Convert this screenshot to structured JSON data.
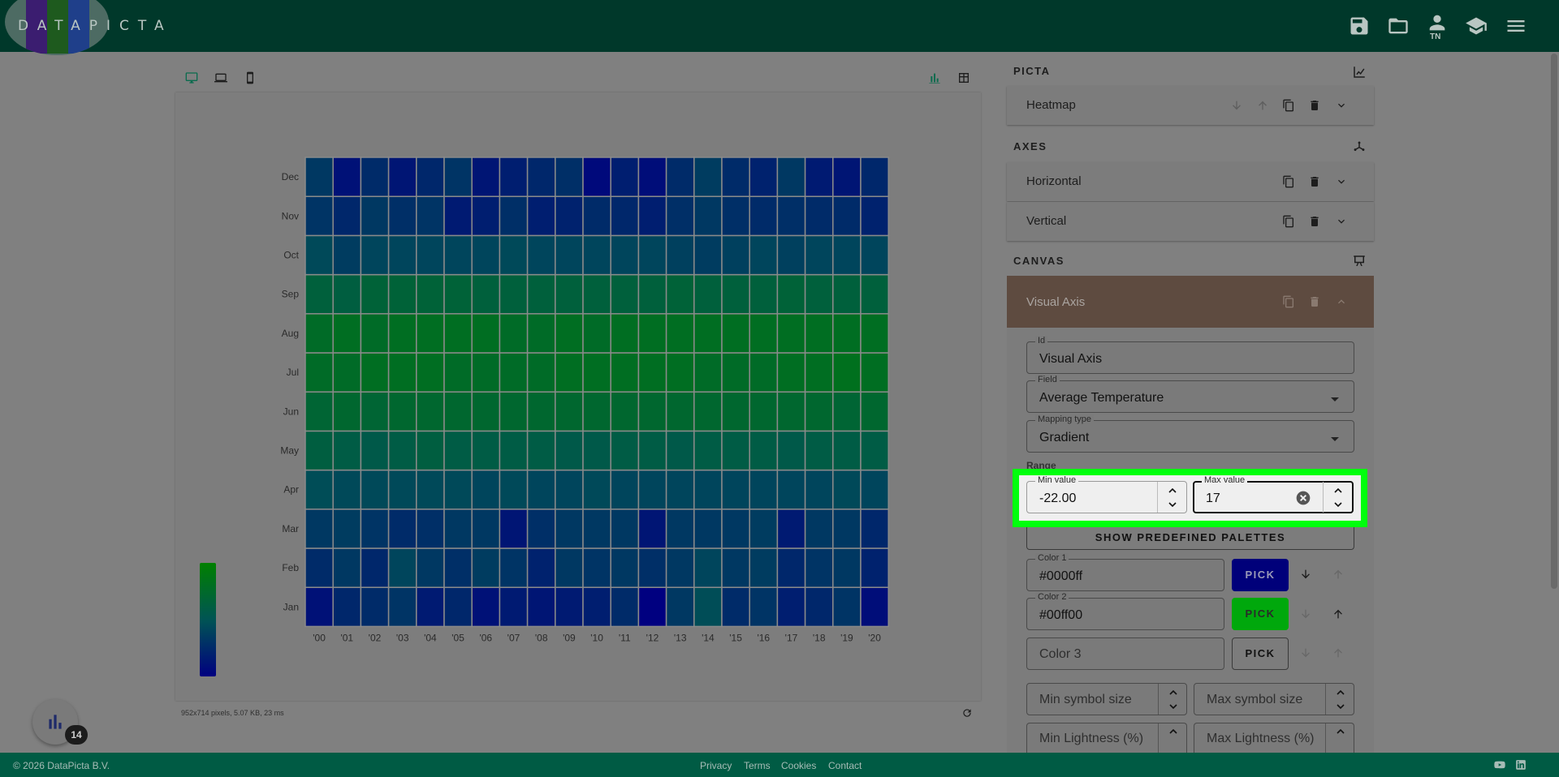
{
  "app": {
    "logo_text": "DATAPICTA",
    "topbar_icons": [
      "save-icon",
      "folder-open-icon",
      "user-icon",
      "school-icon",
      "menu-icon"
    ],
    "user_initials": "TN"
  },
  "workspace": {
    "device_icons": [
      "desktop-icon",
      "laptop-icon",
      "phone-icon"
    ],
    "view_icons": [
      "chart-view-icon",
      "table-view-icon"
    ],
    "status": "952x714 pixels, 5.07 KB, 23 ms",
    "fab_badge": "14"
  },
  "panel": {
    "picta_title": "PICTA",
    "picta_item": "Heatmap",
    "axes_title": "AXES",
    "axes_items": [
      "Horizontal",
      "Vertical"
    ],
    "canvas_title": "CANVAS",
    "visual_title": "Visual Axis",
    "id_label": "Id",
    "id_value": "Visual Axis",
    "field_label": "Field",
    "field_value": "Average Temperature",
    "mapping_label": "Mapping type",
    "mapping_value": "Gradient",
    "range_label": "Range",
    "min_label": "Min value",
    "min_value": "-22.00",
    "max_label": "Max value",
    "max_value": "17",
    "palettes_button": "SHOW PREDEFINED PALETTES",
    "color1_label": "Color 1",
    "color1_value": "#0000ff",
    "color2_label": "Color 2",
    "color2_value": "#00ff00",
    "color3_placeholder": "Color 3",
    "pick_label": "PICK",
    "min_symbol_placeholder": "Min symbol size",
    "max_symbol_placeholder": "Max symbol size",
    "min_lightness_placeholder": "Min Lightness (%)",
    "max_lightness_placeholder": "Max Lightness (%)"
  },
  "footer": {
    "copyright": "© 2026 DataPicta B.V.",
    "links": [
      "Privacy",
      "Terms",
      "Cookies",
      "Contact"
    ],
    "social_icons": [
      "youtube-icon",
      "linkedin-icon"
    ]
  },
  "colors": {
    "color1": "#0000ff",
    "color2": "#00ff00",
    "highlight": "#00ff0d"
  },
  "chart_data": {
    "type": "heatmap",
    "x": [
      "'00",
      "'01",
      "'02",
      "'03",
      "'04",
      "'05",
      "'06",
      "'07",
      "'08",
      "'09",
      "'10",
      "'11",
      "'12",
      "'13",
      "'14",
      "'15",
      "'16",
      "'17",
      "'18",
      "'19",
      "'20"
    ],
    "y": [
      "Jan",
      "Feb",
      "Mar",
      "Apr",
      "May",
      "Jun",
      "Jul",
      "Aug",
      "Sep",
      "Oct",
      "Nov",
      "Dec"
    ],
    "scale": {
      "min": -22,
      "max": 17,
      "colors": [
        "#0000ff",
        "#00ff00"
      ]
    },
    "values": [
      [
        -18,
        -13,
        -12,
        -10,
        -16,
        -13,
        -18,
        -16,
        -17,
        -16,
        -15,
        -12,
        -22,
        -9,
        -4,
        -12,
        -10,
        -15,
        -13,
        -10,
        -19
      ],
      [
        -12,
        -9,
        -13,
        -6,
        -9,
        -11,
        -8,
        -10,
        -14,
        -9,
        -10,
        -9,
        -11,
        -9,
        -6,
        -9,
        -8,
        -13,
        -10,
        -9,
        -14
      ],
      [
        -9,
        -8,
        -10,
        -12,
        -11,
        -9,
        -9,
        -17,
        -11,
        -9,
        -9,
        -9,
        -17,
        -9,
        -9,
        -9,
        -8,
        -16,
        -9,
        -9,
        -13
      ],
      [
        -4,
        -5,
        -5,
        -5,
        -5,
        -5,
        -6,
        -5,
        -6,
        -6,
        -5,
        -6,
        -6,
        -6,
        -6,
        -6,
        -6,
        -6,
        -6,
        -5,
        -6
      ],
      [
        2,
        1,
        0,
        1,
        2,
        1,
        1,
        1,
        1,
        0,
        0,
        1,
        1,
        0,
        1,
        1,
        1,
        0,
        1,
        1,
        1
      ],
      [
        5,
        6,
        5,
        6,
        6,
        6,
        6,
        6,
        6,
        6,
        6,
        6,
        6,
        6,
        6,
        6,
        6,
        6,
        6,
        5,
        6
      ],
      [
        8,
        8,
        9,
        9,
        9,
        8,
        8,
        8,
        8,
        9,
        9,
        9,
        9,
        9,
        8,
        8,
        8,
        9,
        9,
        10,
        9
      ],
      [
        8,
        9,
        8,
        9,
        9,
        9,
        9,
        8,
        8,
        9,
        8,
        9,
        9,
        9,
        9,
        9,
        9,
        9,
        9,
        9,
        9
      ],
      [
        3,
        2,
        4,
        4,
        4,
        4,
        3,
        3,
        3,
        3,
        3,
        3,
        3,
        4,
        3,
        3,
        3,
        4,
        3,
        3,
        3
      ],
      [
        -5,
        -8,
        -6,
        -6,
        -6,
        -6,
        -6,
        -5,
        -6,
        -6,
        -6,
        -6,
        -6,
        -7,
        -8,
        -7,
        -6,
        -7,
        -6,
        -6,
        -6
      ],
      [
        -10,
        -13,
        -9,
        -11,
        -10,
        -16,
        -15,
        -11,
        -15,
        -14,
        -12,
        -13,
        -15,
        -11,
        -9,
        -11,
        -12,
        -11,
        -12,
        -12,
        -14
      ],
      [
        -9,
        -18,
        -12,
        -17,
        -13,
        -10,
        -17,
        -15,
        -13,
        -11,
        -20,
        -15,
        -19,
        -12,
        -8,
        -12,
        -14,
        -9,
        -16,
        -17,
        -13
      ]
    ]
  }
}
